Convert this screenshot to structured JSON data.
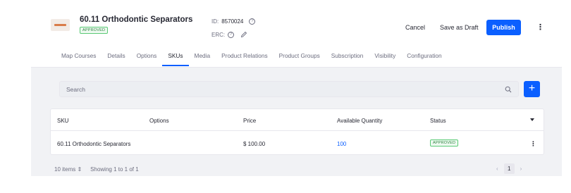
{
  "product": {
    "title": "60.11 Orthodontic Separators",
    "status": "APPROVED",
    "id_label": "ID:",
    "id_value": "8570024",
    "erc_label": "ERC:"
  },
  "actions": {
    "cancel": "Cancel",
    "save_draft": "Save as Draft",
    "publish": "Publish"
  },
  "tabs": [
    "Map Courses",
    "Details",
    "Options",
    "SKUs",
    "Media",
    "Product Relations",
    "Product Groups",
    "Subscription",
    "Visibility",
    "Configuration"
  ],
  "active_tab": "SKUs",
  "search": {
    "placeholder": "Search"
  },
  "table": {
    "headers": [
      "SKU",
      "Options",
      "Price",
      "Available Quantity",
      "Status"
    ],
    "rows": [
      {
        "sku": "60.11 Orthodontic Separators",
        "options": "",
        "price": "$ 100.00",
        "quantity": "100",
        "status": "APPROVED"
      }
    ]
  },
  "footer": {
    "items_per_page": "10 items ⇕",
    "showing": "Showing 1 to 1 of 1",
    "current_page": "1",
    "prev": "‹",
    "next": "›"
  },
  "colors": {
    "primary": "#0b5fff",
    "success": "#2e8540",
    "muted": "#6b6c7e"
  }
}
